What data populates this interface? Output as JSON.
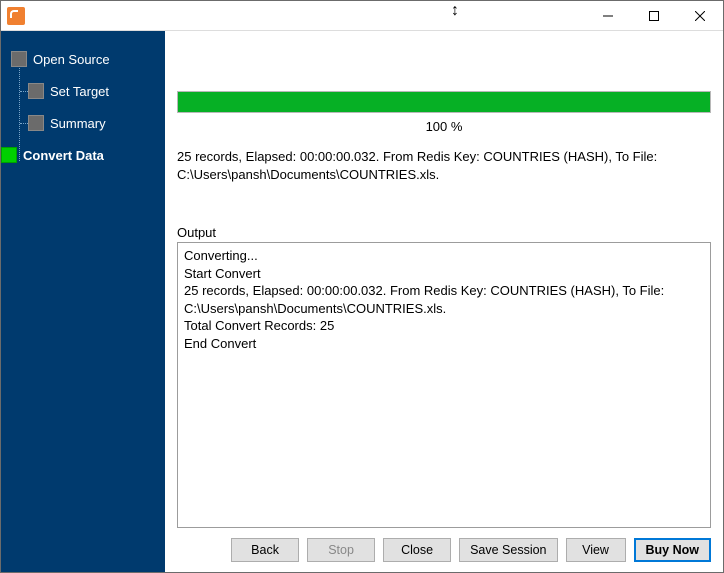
{
  "sidebar": {
    "items": [
      {
        "label": "Open Source"
      },
      {
        "label": "Set Target"
      },
      {
        "label": "Summary"
      },
      {
        "label": "Convert Data"
      }
    ]
  },
  "progress": {
    "percent_text": "100 %"
  },
  "status": {
    "text": "25 records,    Elapsed: 00:00:00.032.    From Redis Key: COUNTRIES (HASH),    To File: C:\\Users\\pansh\\Documents\\COUNTRIES.xls."
  },
  "output": {
    "label": "Output",
    "lines": "Converting...\nStart Convert\n25 records,    Elapsed: 00:00:00.032.    From Redis Key: COUNTRIES (HASH),    To File: C:\\Users\\pansh\\Documents\\COUNTRIES.xls.\nTotal Convert Records: 25\nEnd Convert"
  },
  "buttons": {
    "back": "Back",
    "stop": "Stop",
    "close": "Close",
    "save_session": "Save Session",
    "view": "View",
    "buy_now": "Buy Now"
  }
}
